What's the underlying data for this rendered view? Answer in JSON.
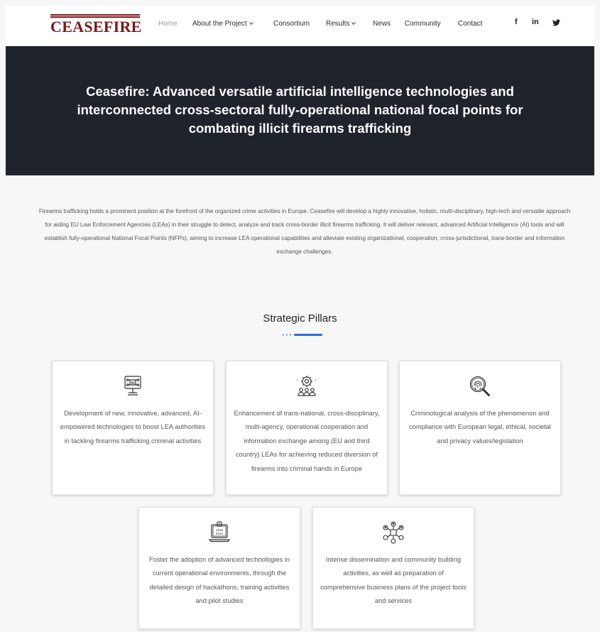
{
  "header": {
    "logo_text": "CEASEFIRE",
    "nav": [
      {
        "label": "Home",
        "active": true,
        "dropdown": false
      },
      {
        "label": "About the Project",
        "active": false,
        "dropdown": true
      },
      {
        "label": "Consortium",
        "active": false,
        "dropdown": false
      },
      {
        "label": "Results",
        "active": false,
        "dropdown": true
      },
      {
        "label": "News",
        "active": false,
        "dropdown": false
      },
      {
        "label": "Community",
        "active": false,
        "dropdown": false
      },
      {
        "label": "Contact",
        "active": false,
        "dropdown": false
      }
    ],
    "social": [
      {
        "icon": "facebook-icon",
        "label": "f"
      },
      {
        "icon": "linkedin-icon",
        "label": "in"
      },
      {
        "icon": "twitter-icon",
        "label": ""
      }
    ]
  },
  "hero": {
    "title": "Ceasefire: Advanced versatile artificial intelligence technologies and interconnected cross-sectoral fully-operational national focal points for combating illicit firearms trafficking"
  },
  "intro": {
    "text": "Firearms trafficking holds a prominent position at the forefront of the organized crime activities in Europe. Ceasefire will develop a highly innovative, holistic, multi-disciplinary, high-tech and versatile approach for aiding EU Law Enforcement Agencies (LEAs) in their struggle to detect, analyze and track cross-border illicit firearms trafficking. It will deliver relevant, advanced Artificial Intelligence (AI) tools and will establish fully-operational National Focal Points (NFPs), aiming to increase LEA operational capabilities and alleviate existing organizational, cooperation, cross-jurisdictional, trans-border and information exchange challenges."
  },
  "pillars": {
    "title": "Strategic Pillars",
    "accent_color": "#2a6fdb",
    "items": [
      {
        "icon": "ai-chip-icon",
        "text": "Development of new, innovative, advanced, AI-empowered technologies to boost LEA authorities in tackling firearms trafficking criminal activities"
      },
      {
        "icon": "team-gear-icon",
        "text": "Enhancement of trans-national, cross-disciplinary, multi-agency, operational cooperation and information exchange among (EU and third country) LEAs for achieving reduced diversion of firearms into criminal hands in Europe"
      },
      {
        "icon": "fingerprint-search-icon",
        "text": "Criminological analysis of the phenomenon and compliance with European legal, ethical, societal and privacy values/legislation"
      },
      {
        "icon": "laptop-binary-icon",
        "text": "Foster the adoption of advanced technologies in current operational environments, through the detailed design of hackathons, training activities and pilot studies"
      },
      {
        "icon": "network-community-icon",
        "text": "Intense dissemination and community building activities, as well as preparation of comprehensive business plans of the project tools and services"
      }
    ]
  },
  "colors": {
    "brand": "#7d1515",
    "hero_bg": "#1e232c",
    "accent": "#2a6fdb"
  }
}
